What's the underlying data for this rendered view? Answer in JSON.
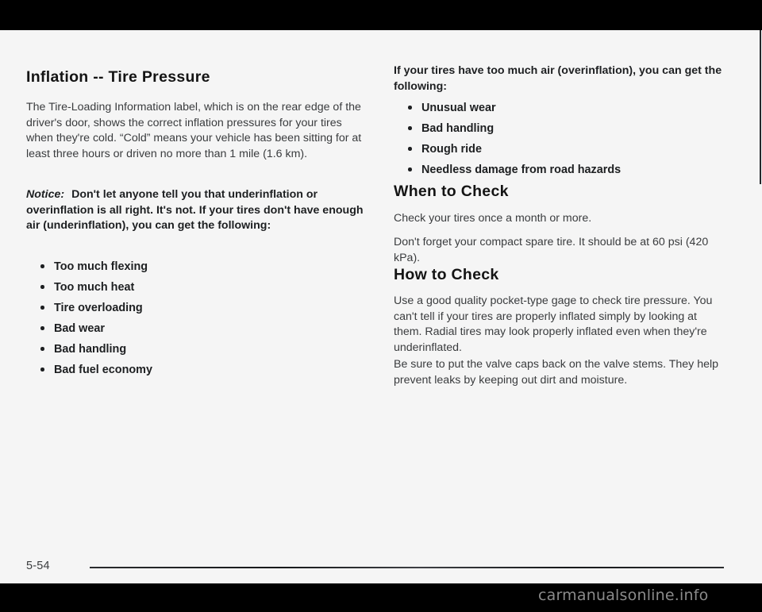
{
  "document": {
    "folio": "5-54",
    "watermark": "carmanualsonline.info"
  },
  "left_column": {
    "heading": "Inflation -- Tire Pressure",
    "intro_paragraph": "The Tire-Loading Information label, which is on the rear edge of the driver's door, shows the correct inflation pressures for your tires when they're cold. “Cold” means your vehicle has been sitting for at least three hours or driven no more than 1 mile (1.6 km).",
    "notice_label": "Notice:",
    "notice_text": "Don't let anyone tell you that underinflation or overinflation is all right. It's not. If your tires don't have enough air (underinflation), you can get the following:",
    "underinflation_bullets": [
      "Too much flexing",
      "Too much heat",
      "Tire overloading",
      "Bad wear",
      "Bad handling",
      "Bad fuel economy"
    ]
  },
  "right_column": {
    "overinflation_intro": "If your tires have too much air (overinflation), you can get the following:",
    "overinflation_bullets": [
      "Unusual wear",
      "Bad handling",
      "Rough ride",
      "Needless damage from road hazards"
    ],
    "when_to_check": {
      "heading": "When to Check",
      "paragraph_1": "Check your tires once a month or more.",
      "paragraph_2": "Don't forget your compact spare tire. It should be at 60 psi (420 kPa)."
    },
    "how_to_check": {
      "heading": "How to Check",
      "paragraph_1": "Use a good quality pocket-type gage to check tire pressure. You can't tell if your tires are properly inflated simply by looking at them. Radial tires may look properly inflated even when they're underinflated.",
      "paragraph_2": "Be sure to put the valve caps back on the valve stems. They help prevent leaks by keeping out dirt and moisture."
    }
  }
}
